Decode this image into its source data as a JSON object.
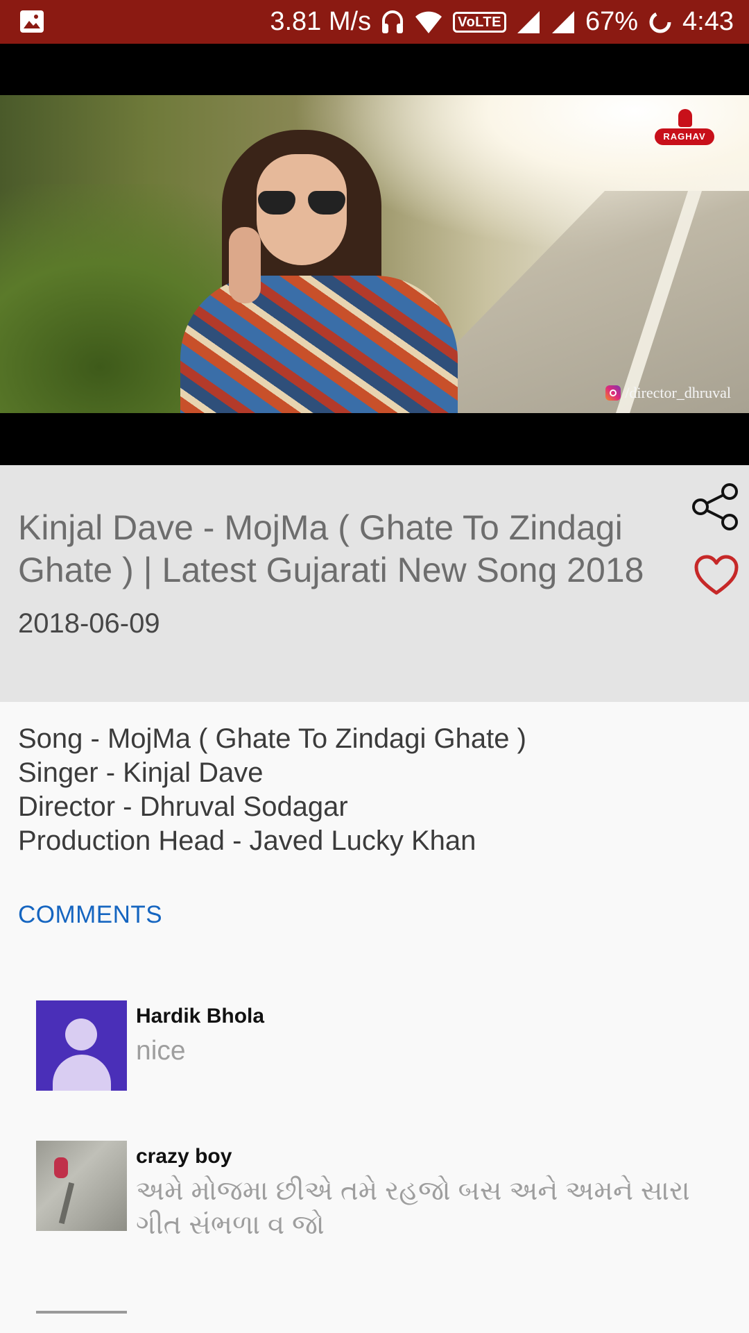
{
  "status_bar": {
    "speed": "3.81 M/s",
    "volte": "VoLTE",
    "battery": "67%",
    "time": "4:43",
    "icons": [
      "gallery-icon",
      "headphones-icon",
      "wifi-icon",
      "signal-icon",
      "battery-icon"
    ]
  },
  "video": {
    "logo_text": "RAGHAV",
    "watermark": "/director_dhruval"
  },
  "info": {
    "title": "Kinjal Dave - MojMa ( Ghate To Zindagi Ghate ) | Latest Gujarati New Song 2018",
    "date": "2018-06-09",
    "icons": [
      "share-icon",
      "heart-icon"
    ],
    "accent_color": "#c62828"
  },
  "description": {
    "lines": [
      "Song - MojMa ( Ghate To Zindagi Ghate )",
      "Singer - Kinjal Dave",
      "Director - Dhruval Sodagar",
      "Production Head - Javed Lucky Khan"
    ]
  },
  "comments": {
    "heading": "COMMENTS",
    "heading_color": "#1565c0",
    "items": [
      {
        "author": "Hardik Bhola",
        "text": "nice"
      },
      {
        "author": "crazy boy",
        "text": "અમે મોજમા છીએ તમે રહજો બસ અને અમને સારા ગીત સંભળા વ જો"
      }
    ]
  }
}
